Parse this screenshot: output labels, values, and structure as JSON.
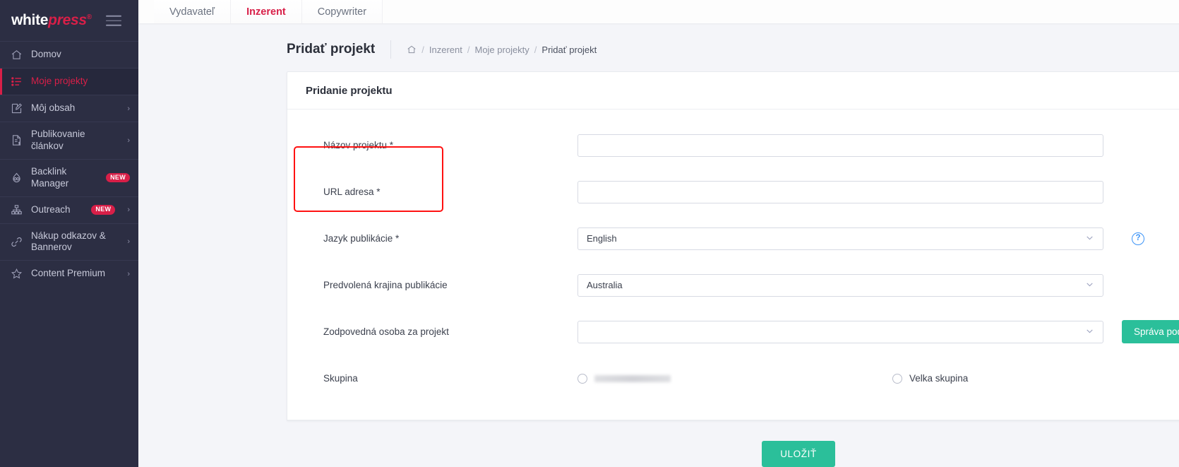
{
  "brand": {
    "part1": "white",
    "part2": "press",
    "reg": "®"
  },
  "sidebar": {
    "items": [
      {
        "label": "Domov",
        "icon": "home-icon",
        "badge": null,
        "chevron": false,
        "active": false
      },
      {
        "label": "Moje projekty",
        "icon": "list-icon",
        "badge": null,
        "chevron": false,
        "active": true
      },
      {
        "label": "Môj obsah",
        "icon": "edit-square-icon",
        "badge": null,
        "chevron": true,
        "active": false
      },
      {
        "label": "Publikovanie článkov",
        "icon": "document-dollar-icon",
        "badge": null,
        "chevron": true,
        "active": false
      },
      {
        "label": "Backlink Manager",
        "icon": "backlink-icon",
        "badge": "NEW",
        "chevron": false,
        "active": false
      },
      {
        "label": "Outreach",
        "icon": "sitemap-icon",
        "badge": "NEW",
        "chevron": true,
        "active": false
      },
      {
        "label": "Nákup odkazov & Bannerov",
        "icon": "link-icon",
        "badge": null,
        "chevron": true,
        "active": false
      },
      {
        "label": "Content Premium",
        "icon": "star-icon",
        "badge": null,
        "chevron": true,
        "active": false
      }
    ]
  },
  "topbar": {
    "tabs": [
      {
        "label": "Vydavateľ",
        "active": false
      },
      {
        "label": "Inzerent",
        "active": true
      },
      {
        "label": "Copywriter",
        "active": false
      }
    ],
    "account": ""
  },
  "pagehead": {
    "title": "Pridať projekt",
    "breadcrumb": {
      "home_icon": "home-icon",
      "items": [
        "Inzerent",
        "Moje projekty",
        "Pridať projekt"
      ],
      "separator": "/"
    }
  },
  "card": {
    "heading": "Pridanie projektu",
    "fields": {
      "name": {
        "label": "Názov projektu *",
        "value": "",
        "placeholder": ""
      },
      "url": {
        "label": "URL adresa *",
        "value": "",
        "placeholder": ""
      },
      "language": {
        "label": "Jazyk publikácie *",
        "value": "English",
        "caret": "chevron-down-icon"
      },
      "country": {
        "label": "Predvolená krajina publikácie",
        "value": "Australia",
        "caret": "chevron-down-icon"
      },
      "person": {
        "label": "Zodpovedná osoba za projekt",
        "value": "",
        "caret": "chevron-down-icon"
      },
      "group": {
        "label": "Skupina"
      }
    },
    "help_icon_label": "?",
    "subaccounts_button": "Správa podúčtov",
    "radios": [
      {
        "label": "",
        "redacted": true,
        "selected": false
      },
      {
        "label": "Velka skupina",
        "redacted": false,
        "selected": false
      }
    ]
  },
  "footer": {
    "save_button": "ULOŽIŤ"
  },
  "colors": {
    "sidebar_bg": "#2c2e43",
    "accent_red": "#d81f48",
    "teal": "#2bbf9a",
    "annotation_red": "#ff1111",
    "help_blue": "#3b93f7",
    "page_bg": "#f4f5f9"
  }
}
